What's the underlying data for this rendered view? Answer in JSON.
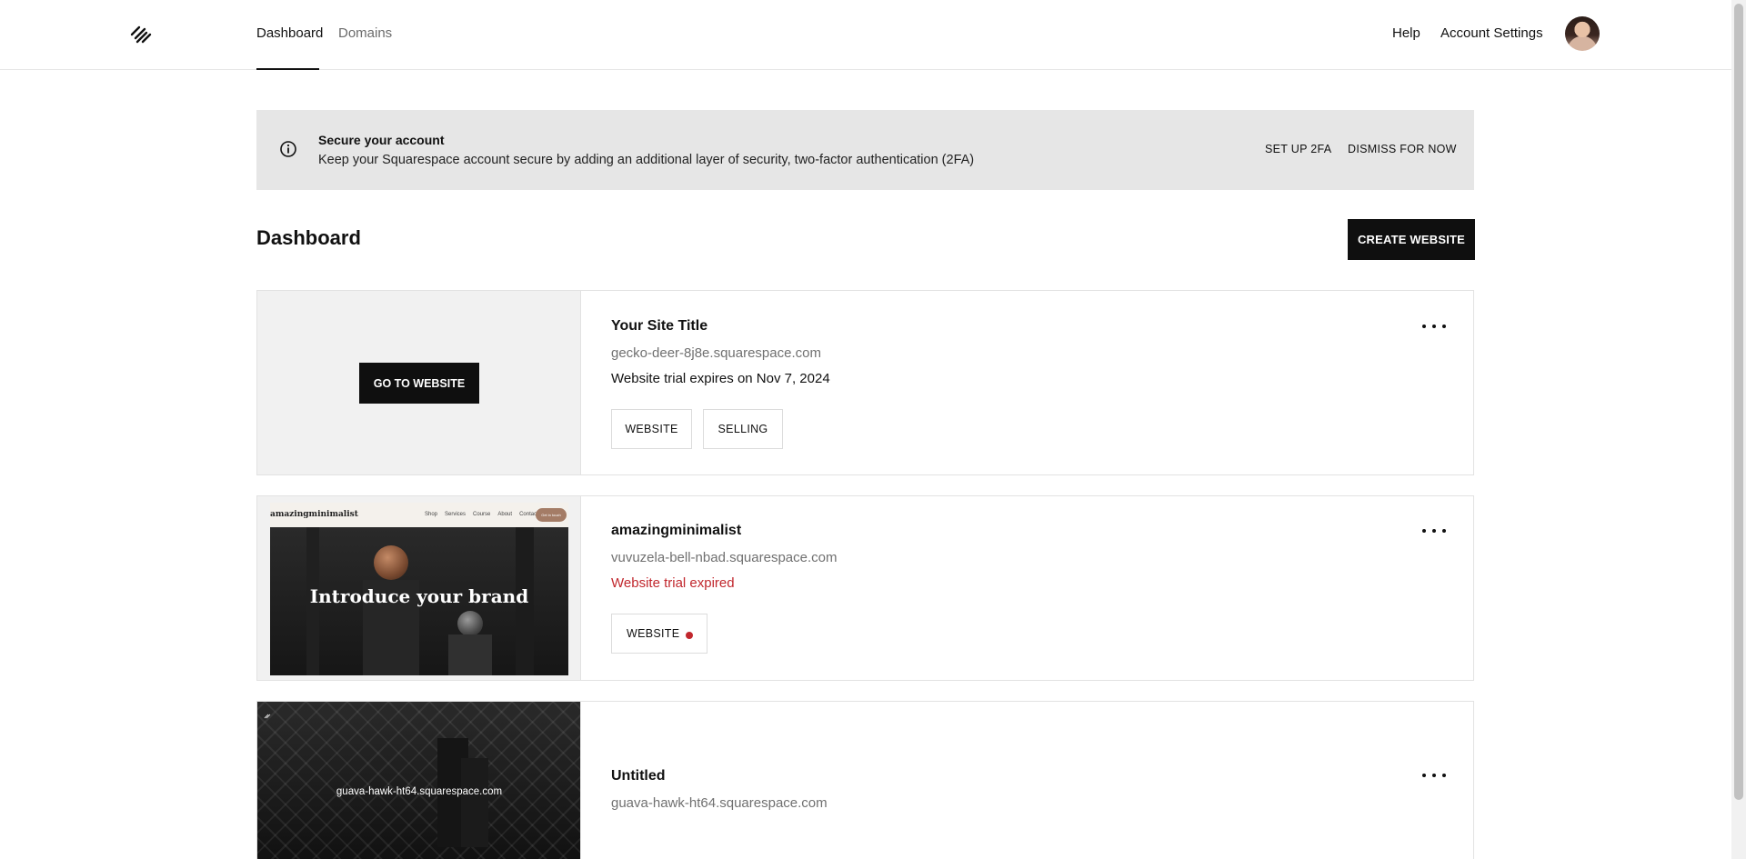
{
  "header": {
    "tabs": [
      {
        "label": "Dashboard",
        "active": true
      },
      {
        "label": "Domains",
        "active": false
      }
    ],
    "help_label": "Help",
    "account_settings_label": "Account Settings",
    "logo_icon": "squarespace-logo-icon",
    "avatar_icon": "user-avatar"
  },
  "banner": {
    "title": "Secure your account",
    "text": "Keep your Squarespace account secure by adding an additional layer of security, two-factor authentication (2FA)",
    "setup_label": "SET UP 2FA",
    "dismiss_label": "DISMISS FOR NOW",
    "icon": "info-icon"
  },
  "dashboard": {
    "title": "Dashboard",
    "create_label": "CREATE WEBSITE"
  },
  "sites": [
    {
      "title": "Your Site Title",
      "url": "gecko-deer-8j8e.squarespace.com",
      "status": "Website trial expires on Nov 7, 2024",
      "go_label": "GO TO WEBSITE",
      "buttons": [
        "WEBSITE",
        "SELLING"
      ]
    },
    {
      "title": "amazingminimalist",
      "url": "vuvuzela-bell-nbad.squarespace.com",
      "status": "Website trial expired",
      "status_color": "#c1272d",
      "buttons": [
        "WEBSITE"
      ],
      "preview": {
        "brand": "amazingminimalist",
        "nav": [
          "Shop",
          "Services",
          "Course",
          "About",
          "Contact"
        ],
        "nav_button": "Get in touch",
        "headline": "Introduce your brand"
      }
    },
    {
      "title": "Untitled",
      "url": "guava-hawk-ht64.squarespace.com",
      "preview_text": "guava-hawk-ht64.squarespace.com"
    }
  ],
  "colors": {
    "accent": "#0f0f0f",
    "banner_bg": "#e6e6e6",
    "expired": "#c1272d"
  }
}
